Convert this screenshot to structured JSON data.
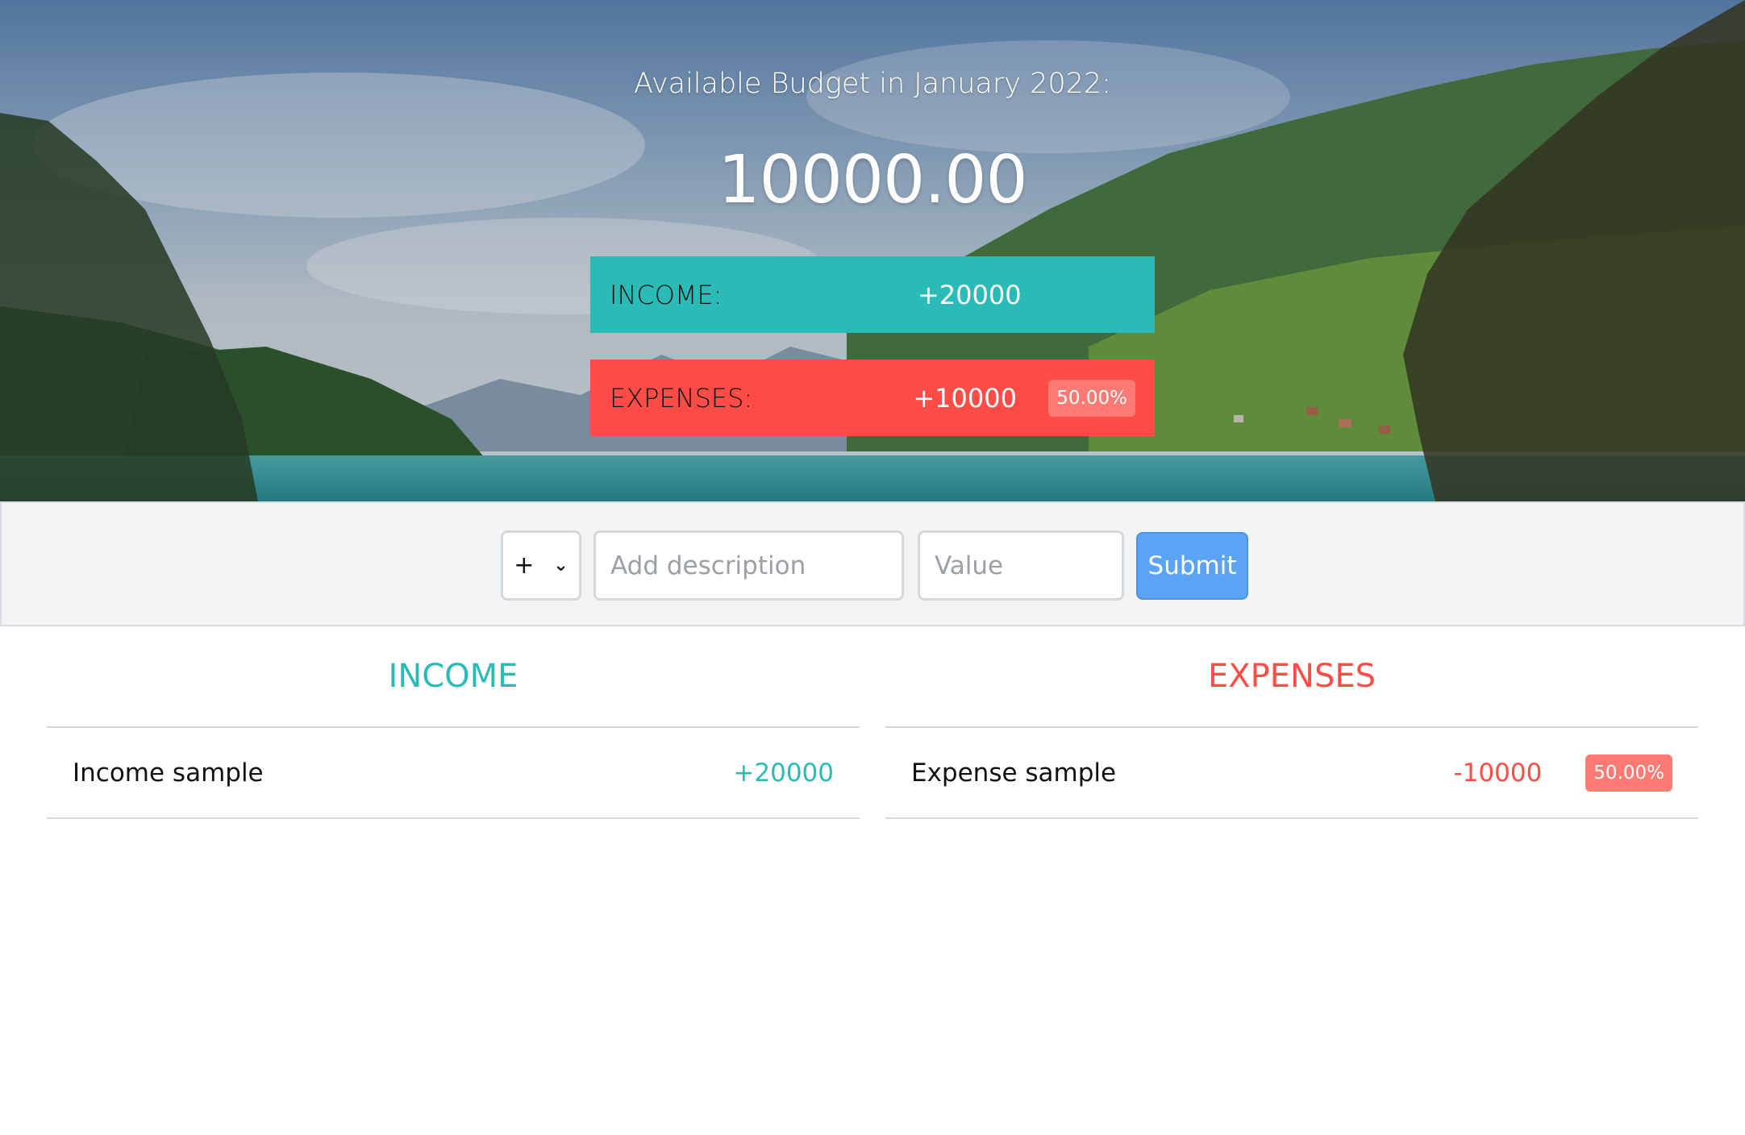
{
  "header": {
    "title": "Available Budget in January 2022:",
    "budget": "10000.00"
  },
  "summary": {
    "income": {
      "label": "Income:",
      "value": "+20000"
    },
    "expenses": {
      "label": "Expenses:",
      "value": "+10000",
      "percentage": "50.00%"
    }
  },
  "add_form": {
    "type_value": "+",
    "description_placeholder": "Add description",
    "value_placeholder": "Value",
    "submit_label": "Submit"
  },
  "income_list": {
    "heading": "Income",
    "items": [
      {
        "description": "Income sample",
        "value": "+20000"
      }
    ]
  },
  "expenses_list": {
    "heading": "Expenses",
    "items": [
      {
        "description": "Expense sample",
        "value": "-10000",
        "percentage": "50.00%"
      }
    ]
  },
  "colors": {
    "income": "#2bbbb7",
    "expenses": "#ff4c46",
    "percentage_badge": "#ff7a73",
    "submit": "#5ba4f5"
  }
}
